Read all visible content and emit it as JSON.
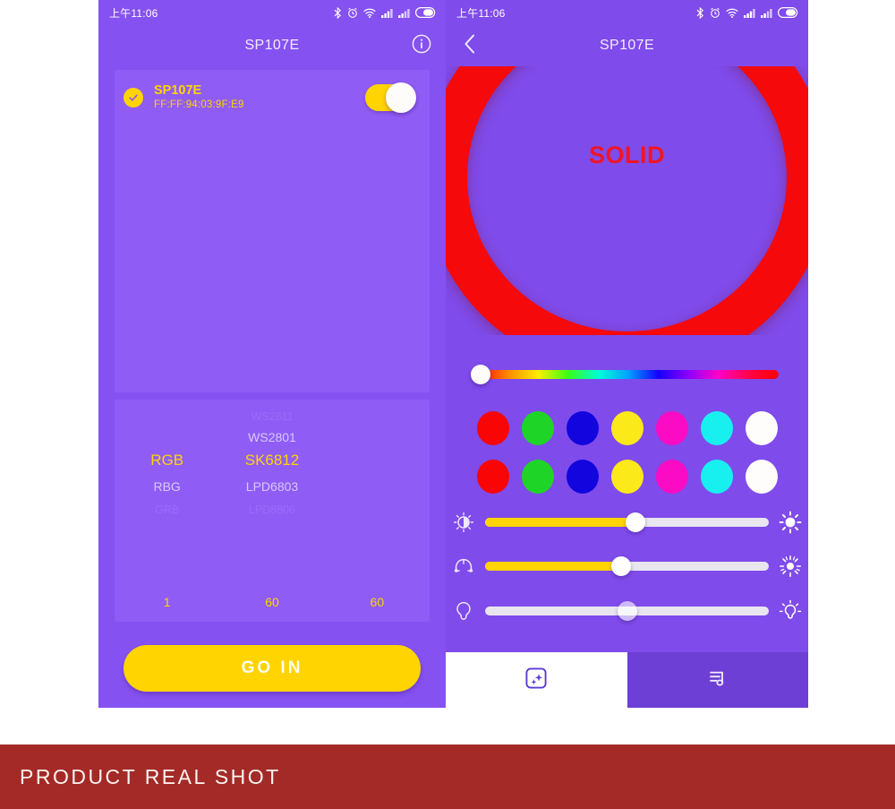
{
  "theme": {
    "purple_bg": "#8551f0",
    "card_purple": "#8f5df5",
    "accent_yellow": "#ffd400",
    "ring_red": "#f5090b",
    "banner_red": "#a32a27",
    "tab_inactive_purple": "#6d3fd4"
  },
  "left_phone": {
    "statusbar": {
      "time": "上午11:06",
      "icons": [
        "bluetooth-icon",
        "alarm-icon",
        "wifi-icon",
        "signal-icon",
        "signal-icon",
        "battery-icon"
      ]
    },
    "appbar": {
      "title": "SP107E",
      "info_icon": "info-circle-icon"
    },
    "device_list": [
      {
        "name": "SP107E",
        "mac": "FF:FF:94:03:9F:E9",
        "selected": true,
        "power_on": true,
        "check_icon": "check-circle-icon"
      }
    ],
    "picker": {
      "columns": [
        {
          "name": "order-column",
          "options": [
            "",
            "",
            "RGB",
            "RBG",
            "GRB"
          ],
          "selected_index": 2,
          "selected": "RGB"
        },
        {
          "name": "chip-column",
          "options": [
            "WS2811",
            "WS2801",
            "SK6812",
            "LPD6803",
            "LPD8806"
          ],
          "selected_index": 2,
          "selected": "SK6812"
        },
        {
          "name": "blank-column",
          "options": [
            "",
            "",
            "",
            "",
            ""
          ],
          "selected_index": 2,
          "selected": ""
        }
      ],
      "numbers": [
        "1",
        "60",
        "60"
      ]
    },
    "go_in_label": "GO IN"
  },
  "right_phone": {
    "statusbar": {
      "time": "上午11:06",
      "icons": [
        "bluetooth-icon",
        "alarm-icon",
        "wifi-icon",
        "signal-icon",
        "signal-icon",
        "battery-icon"
      ]
    },
    "appbar": {
      "title": "SP107E",
      "back_icon": "chevron-left-icon"
    },
    "effect": {
      "mode_label": "SOLID",
      "ring_color": "#f5090b"
    },
    "hue_slider": {
      "name": "hue-slider",
      "value_percent": 1
    },
    "swatch_rows": [
      {
        "name": "swatch-row-primary",
        "colors": [
          "#fa0505",
          "#1ed527",
          "#1205dd",
          "#fbe91a",
          "#fb0bc4",
          "#18f0f0",
          "#fefdfb"
        ]
      },
      {
        "name": "swatch-row-secondary",
        "colors": [
          "#fa0505",
          "#1ed527",
          "#1205dd",
          "#fbe91a",
          "#fb0bc4",
          "#18f0f0",
          "#fefdfb"
        ]
      }
    ],
    "sliders": [
      {
        "name": "brightness-slider",
        "left_icon": "contrast-icon",
        "right_icon": "sun-icon",
        "value_percent": 53,
        "filled": true
      },
      {
        "name": "speed-slider",
        "left_icon": "speed-dial-icon",
        "right_icon": "sparkle-sun-icon",
        "value_percent": 48,
        "filled": true
      },
      {
        "name": "warmth-slider",
        "left_icon": "bulb-outline-icon",
        "right_icon": "bulb-glow-icon",
        "value_percent": 50,
        "filled": false
      }
    ],
    "tabs": [
      {
        "name": "tab-effects",
        "icon": "sparkle-square-icon",
        "active": true,
        "label": ""
      },
      {
        "name": "tab-music",
        "icon": "music-note-icon",
        "active": false,
        "label": ""
      }
    ]
  },
  "footer": {
    "banner_text": "PRODUCT REAL SHOT"
  }
}
